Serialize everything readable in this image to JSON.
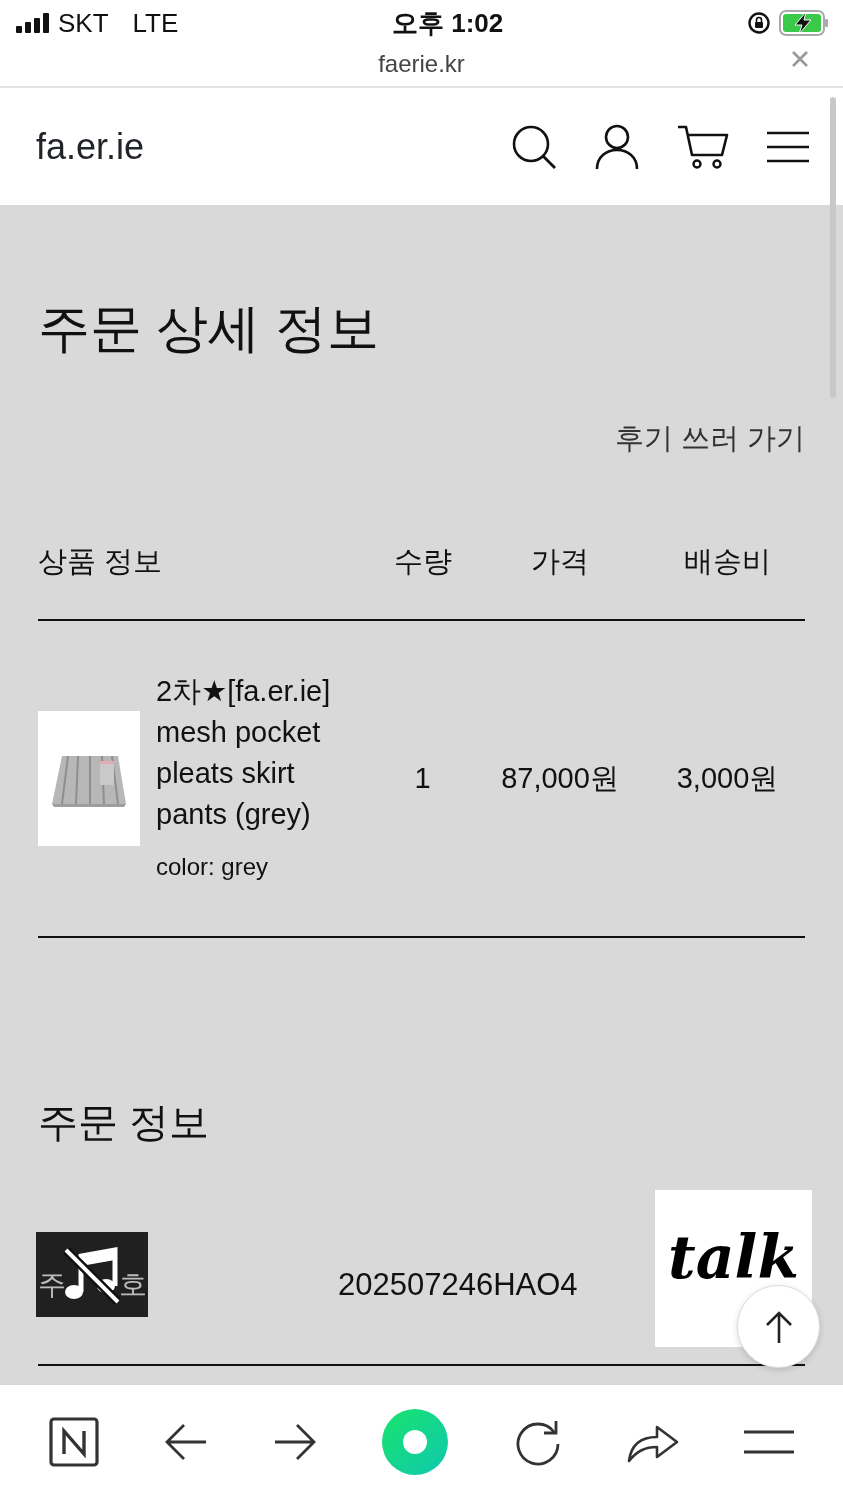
{
  "status_bar": {
    "carrier": "SKT",
    "network": "LTE",
    "time": "오후 1:02",
    "url": "faerie.kr"
  },
  "header": {
    "logo": "fa.er.ie"
  },
  "page_title": "주문 상세 정보",
  "review_link": "후기 쓰러 가기",
  "items_table": {
    "columns": [
      "상품 정보",
      "수량",
      "가격",
      "배송비"
    ],
    "rows": [
      {
        "name": "2차★[fa.er.ie] mesh pocket pleats skirt pants (grey)",
        "option": "color: grey",
        "quantity": "1",
        "price": "87,000원",
        "shipping": "3,000원"
      }
    ]
  },
  "order_info": {
    "title": "주문 정보",
    "rows": [
      {
        "label_parts": [
          "주",
          "호"
        ],
        "value": "202507246HAO4"
      }
    ]
  },
  "chat_button": {
    "label": "talk"
  }
}
